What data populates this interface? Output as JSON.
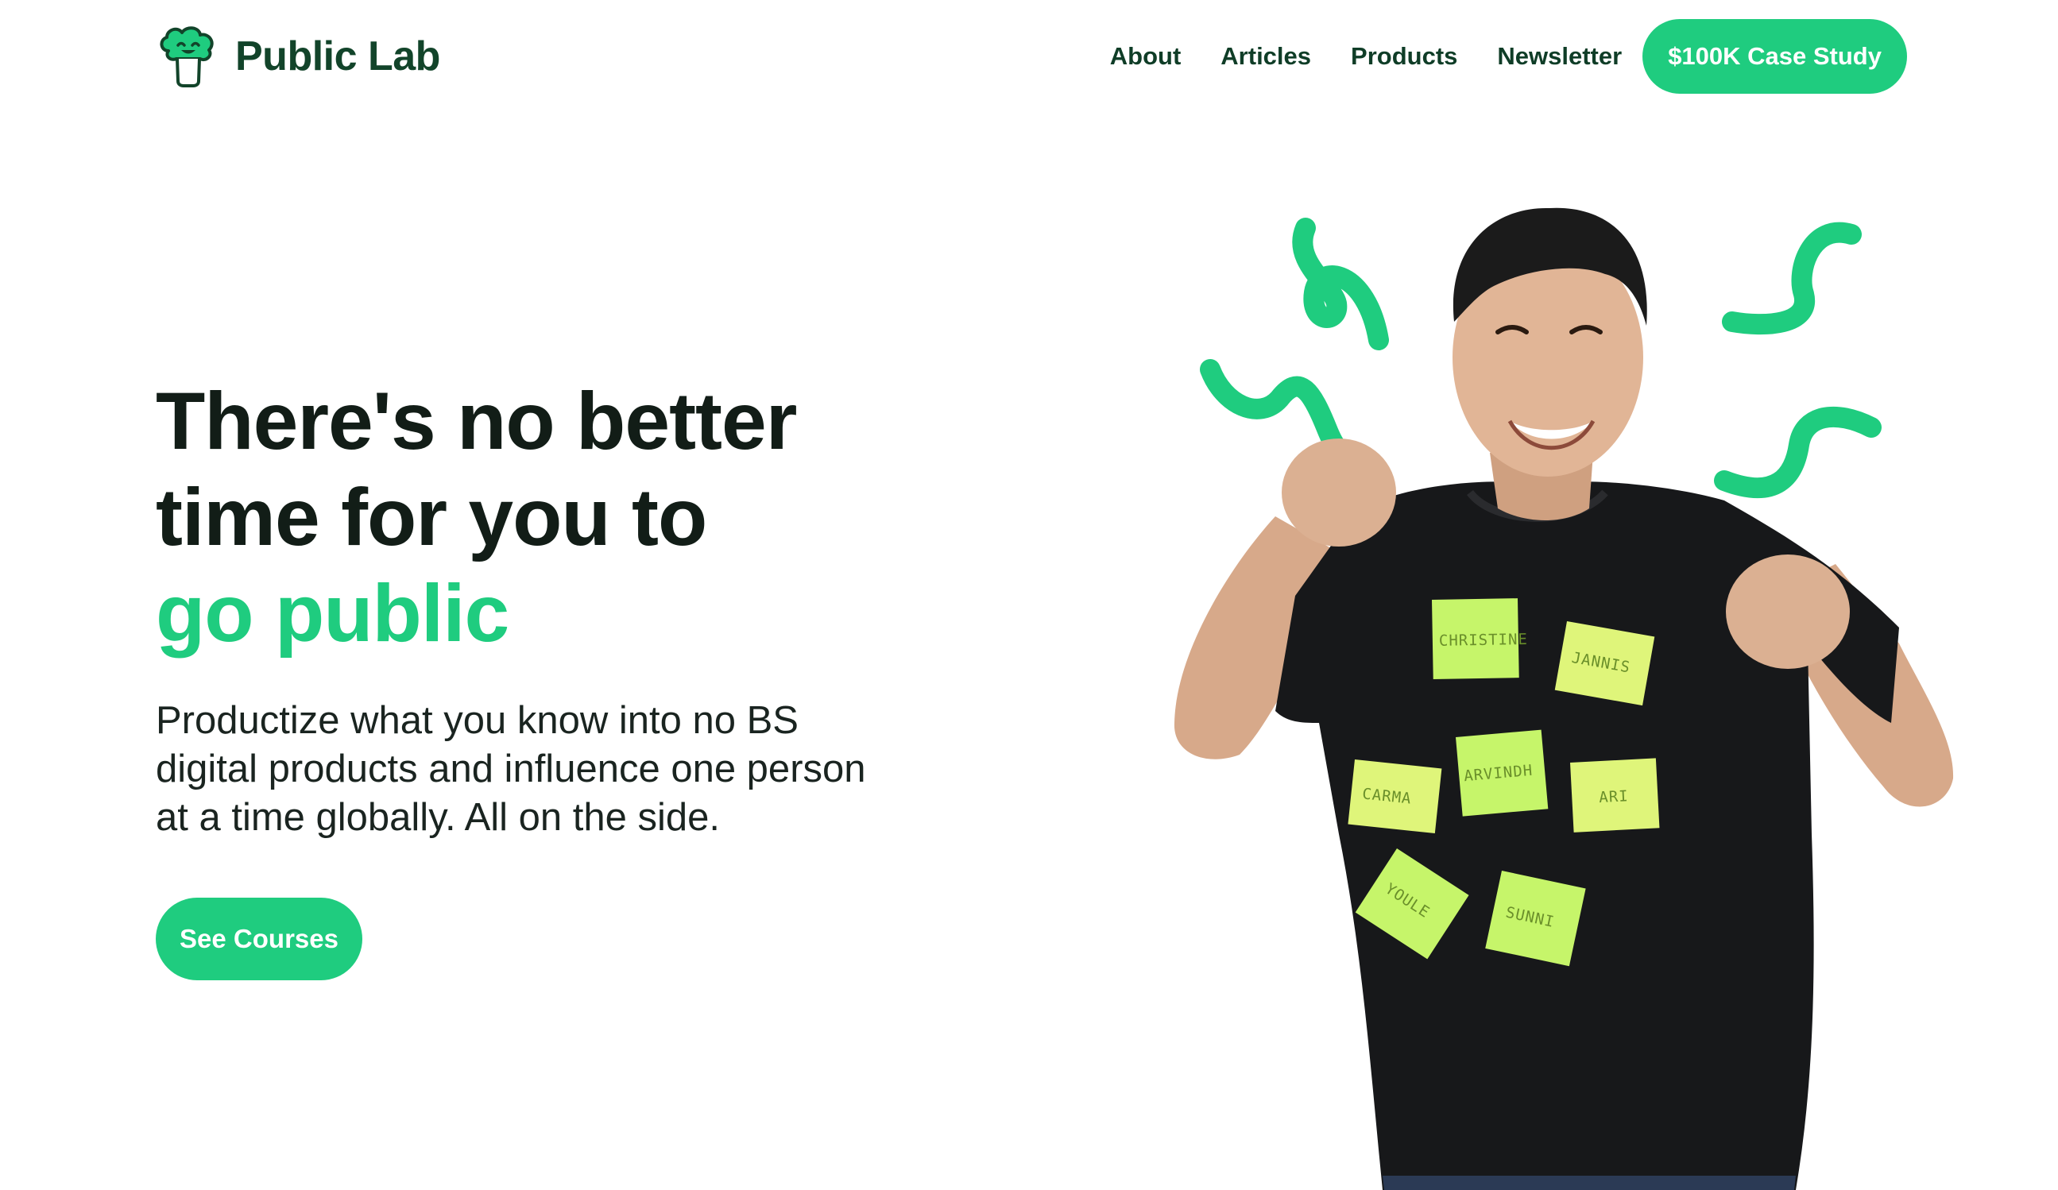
{
  "brand": {
    "name": "Public Lab",
    "logo_icon": "broccoli-icon",
    "accent_color": "#1fcc7f",
    "text_color": "#0f3d27"
  },
  "nav": {
    "items": [
      {
        "label": "About"
      },
      {
        "label": "Articles"
      },
      {
        "label": "Products"
      },
      {
        "label": "Newsletter"
      }
    ],
    "cta_label": "$100K Case Study"
  },
  "hero": {
    "title_line_1": "There's no better",
    "title_line_2": "time for you to",
    "title_accent": "go public",
    "subtitle_line_1": "Productize what you know into no BS",
    "subtitle_line_2": "digital products and influence one person",
    "subtitle_line_3": "at a time globally. All on the side.",
    "cta_label": "See Courses"
  },
  "illustration": {
    "sticky_notes": [
      {
        "label": "CHRISTINE"
      },
      {
        "label": "JANNIS"
      },
      {
        "label": "CARMA"
      },
      {
        "label": "ARVINDH"
      },
      {
        "label": "ARI"
      },
      {
        "label": "YOULE"
      },
      {
        "label": "SUNNI"
      }
    ],
    "note_color": "#c6f56a",
    "squiggle_color": "#1fcc7f",
    "shirt_color": "#17181a"
  }
}
